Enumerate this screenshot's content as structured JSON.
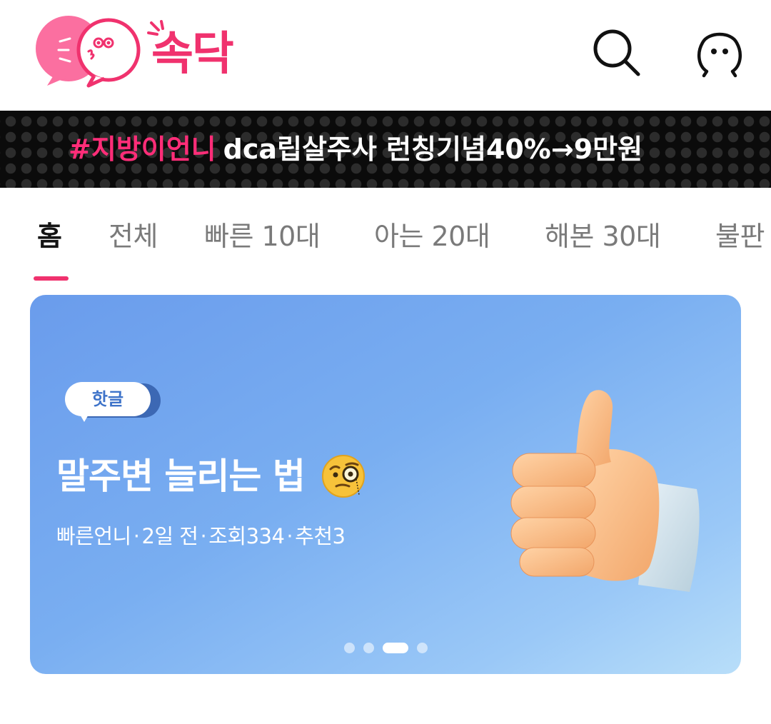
{
  "header": {
    "logo_text": "속닥",
    "search_icon": "search-icon",
    "profile_icon": "profile-icon"
  },
  "ticker": {
    "tag": "#지방이언니",
    "message": "dca립살주사 런칭기념40%→9만원"
  },
  "tabs": [
    {
      "label": "홈",
      "active": true
    },
    {
      "label": "전체"
    },
    {
      "label": "빠른 10대"
    },
    {
      "label": "아는 20대"
    },
    {
      "label": "해본 30대"
    },
    {
      "label": "불판"
    }
  ],
  "card": {
    "badge": "핫글",
    "title": "말주변 늘리는 법",
    "title_emoji": "monocle-face-emoji",
    "author": "빠른언니",
    "time": "2일 전",
    "views": "조회334",
    "recommends": "추천3",
    "carousel_total": 4,
    "carousel_active_index": 2
  },
  "colors": {
    "brand_pink": "#f0326e",
    "ticker_tag": "#ff2d78",
    "card_blue": "#79aef1",
    "badge_text": "#3e73c9"
  }
}
